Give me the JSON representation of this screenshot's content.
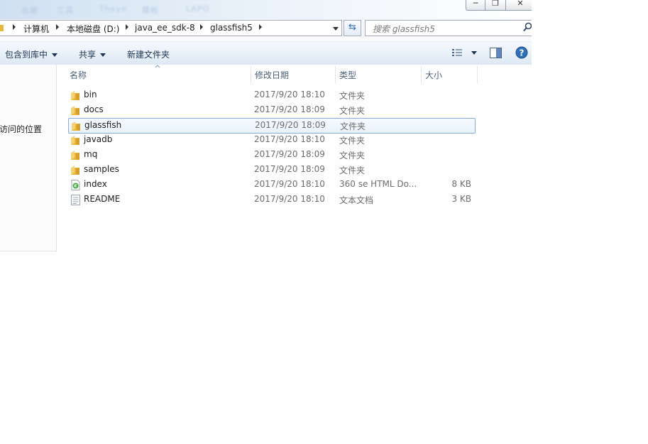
{
  "window": {
    "blurred_title_tabs": [
      "收藏",
      "工具",
      "Theye",
      "模板",
      "LAPO"
    ]
  },
  "address": {
    "crumbs": [
      "计算机",
      "本地磁盘 (D:)",
      "java_ee_sdk-8",
      "glassfish5"
    ]
  },
  "search": {
    "placeholder": "搜索 glassfish5",
    "icon": "magnifier-icon"
  },
  "toolbar": {
    "include_library": "包含到库中",
    "share": "共享",
    "new_folder": "新建文件夹"
  },
  "navpane": {
    "recent_places": "访问的位置"
  },
  "columns": {
    "name": "名称",
    "date": "修改日期",
    "type": "类型",
    "size": "大小"
  },
  "files": [
    {
      "name": "bin",
      "date": "2017/9/20 18:10",
      "type": "文件夹",
      "size": "",
      "icon": "folder-icon"
    },
    {
      "name": "docs",
      "date": "2017/9/20 18:09",
      "type": "文件夹",
      "size": "",
      "icon": "folder-icon"
    },
    {
      "name": "glassfish",
      "date": "2017/9/20 18:09",
      "type": "文件夹",
      "size": "",
      "icon": "folder-icon",
      "selected": true
    },
    {
      "name": "javadb",
      "date": "2017/9/20 18:10",
      "type": "文件夹",
      "size": "",
      "icon": "folder-icon"
    },
    {
      "name": "mq",
      "date": "2017/9/20 18:09",
      "type": "文件夹",
      "size": "",
      "icon": "folder-icon"
    },
    {
      "name": "samples",
      "date": "2017/9/20 18:09",
      "type": "文件夹",
      "size": "",
      "icon": "folder-icon"
    },
    {
      "name": "index",
      "date": "2017/9/20 18:10",
      "type": "360 se HTML Do...",
      "size": "8 KB",
      "icon": "html-file-icon"
    },
    {
      "name": "README",
      "date": "2017/9/20 18:10",
      "type": "文本文档",
      "size": "3 KB",
      "icon": "text-file-icon"
    }
  ],
  "colors": {
    "selection_border": "#84acdd",
    "toolbar_text": "#1e3450",
    "help_blue": "#2f6fb7"
  }
}
